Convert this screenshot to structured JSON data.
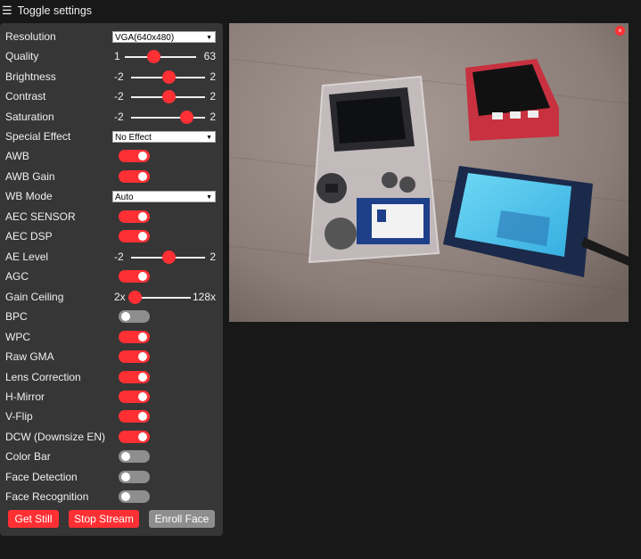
{
  "topbar": {
    "icon": "hamburger-icon",
    "label": "Toggle settings"
  },
  "colors": {
    "accent": "#ff3034",
    "panel": "#363636",
    "background": "#181818",
    "toggle_off": "#8e8e8e"
  },
  "controls": {
    "resolution": {
      "label": "Resolution",
      "value": "VGA(640x480)"
    },
    "quality": {
      "label": "Quality",
      "min": "1",
      "max": "63",
      "level": 0.4
    },
    "brightness": {
      "label": "Brightness",
      "min": "-2",
      "max": "2",
      "level": 0.5
    },
    "contrast": {
      "label": "Contrast",
      "min": "-2",
      "max": "2",
      "level": 0.5
    },
    "saturation": {
      "label": "Saturation",
      "min": "-2",
      "max": "2",
      "level": 0.75
    },
    "special_effect": {
      "label": "Special Effect",
      "value": "No Effect"
    },
    "awb": {
      "label": "AWB",
      "on": true
    },
    "awb_gain": {
      "label": "AWB Gain",
      "on": true
    },
    "wb_mode": {
      "label": "WB Mode",
      "value": "Auto"
    },
    "aec_sensor": {
      "label": "AEC SENSOR",
      "on": true
    },
    "aec_dsp": {
      "label": "AEC DSP",
      "on": true
    },
    "ae_level": {
      "label": "AE Level",
      "min": "-2",
      "max": "2",
      "level": 0.5
    },
    "agc": {
      "label": "AGC",
      "on": true
    },
    "gain_ceiling": {
      "label": "Gain Ceiling",
      "min": "2x",
      "max": "128x",
      "level": 0.0
    },
    "bpc": {
      "label": "BPC",
      "on": false
    },
    "wpc": {
      "label": "WPC",
      "on": true
    },
    "raw_gma": {
      "label": "Raw GMA",
      "on": true
    },
    "lens_correction": {
      "label": "Lens Correction",
      "on": true
    },
    "h_mirror": {
      "label": "H-Mirror",
      "on": true
    },
    "v_flip": {
      "label": "V-Flip",
      "on": true
    },
    "dcw": {
      "label": "DCW (Downsize EN)",
      "on": true
    },
    "color_bar": {
      "label": "Color Bar",
      "on": false
    },
    "face_detection": {
      "label": "Face Detection",
      "on": false
    },
    "face_recognition": {
      "label": "Face Recognition",
      "on": false
    }
  },
  "buttons": {
    "get_still": "Get Still",
    "stop_stream": "Stop Stream",
    "enroll_face": "Enroll Face"
  },
  "stream": {
    "close_symbol": "×"
  }
}
